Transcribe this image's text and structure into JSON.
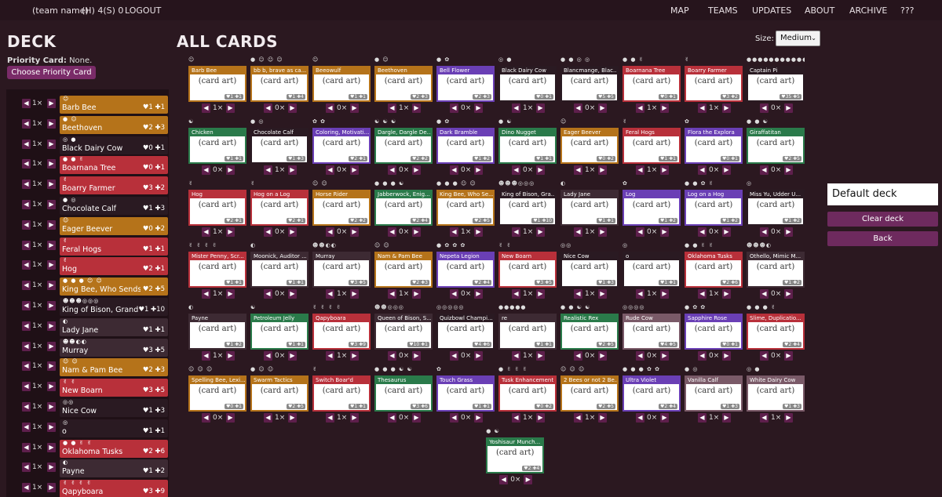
{
  "nav": {
    "team": "(team name)",
    "hunt": "(H) 4(S) 0",
    "logout": "LOGOUT",
    "links": [
      "MAP",
      "TEAMS",
      "UPDATES",
      "ABOUT",
      "ARCHIVE",
      "???"
    ]
  },
  "deck": {
    "title": "DECK",
    "priority_label": "Priority Card:",
    "priority_value": "None.",
    "priority_button": "Choose Priority Card",
    "rows": [
      {
        "name": "Barb Bee",
        "icons": "☺",
        "qty": "1×",
        "stats": "♥1 ✚1",
        "color": "#b5731a"
      },
      {
        "name": "Beethoven",
        "icons": "● ☺",
        "qty": "1×",
        "stats": "♥2 ✚3",
        "color": "#b5731a"
      },
      {
        "name": "Black Dairy Cow",
        "icons": "◎ ●",
        "qty": "1×",
        "stats": "♥0 ✚1",
        "color": "#2a1a22"
      },
      {
        "name": "Boarnana Tree",
        "icons": "● ● ✌",
        "qty": "1×",
        "stats": "♥0 ✚1",
        "color": "#b8303a"
      },
      {
        "name": "Boarry Farmer",
        "icons": "✌",
        "qty": "1×",
        "stats": "♥3 ✚2",
        "color": "#b8303a"
      },
      {
        "name": "Chocolate Calf",
        "icons": "● ◎",
        "qty": "1×",
        "stats": "♥1 ✚3",
        "color": "#2a1a22"
      },
      {
        "name": "Eager Beever",
        "icons": "☺",
        "qty": "1×",
        "stats": "♥0 ✚2",
        "color": "#b5731a"
      },
      {
        "name": "Feral Hogs",
        "icons": "✌",
        "qty": "1×",
        "stats": "♥1 ✚1",
        "color": "#b8303a"
      },
      {
        "name": "Hog",
        "icons": "✌",
        "qty": "1×",
        "stats": "♥2 ✚1",
        "color": "#b8303a"
      },
      {
        "name": "King Bee, Who Sends",
        "icons": "● ● ● ☺ ☺",
        "qty": "1×",
        "stats": "♥2 ✚5",
        "color": "#b5731a"
      },
      {
        "name": "King of Bison, Grand",
        "icons": "☻☻☻◎◎◎",
        "qty": "1×",
        "stats": "♥1 ✚10",
        "color": "#2a1a22"
      },
      {
        "name": "Lady Jane",
        "icons": "◐",
        "qty": "1×",
        "stats": "♥1 ✚1",
        "color": "#3d2a33"
      },
      {
        "name": "Murray",
        "icons": "☻☻◐◐",
        "qty": "1×",
        "stats": "♥3 ✚5",
        "color": "#3d2a33"
      },
      {
        "name": "Nam & Pam Bee",
        "icons": "☺ ☺",
        "qty": "1×",
        "stats": "♥2 ✚3",
        "color": "#b5731a"
      },
      {
        "name": "New Boarn",
        "icons": "✌ ✌",
        "qty": "1×",
        "stats": "♥3 ✚5",
        "color": "#b8303a"
      },
      {
        "name": "Nice Cow",
        "icons": "◎◎",
        "qty": "1×",
        "stats": "♥1 ✚3",
        "color": "#2a1a22"
      },
      {
        "name": "o",
        "icons": "◎",
        "qty": "1×",
        "stats": "♥1 ✚1",
        "color": "#2a1a22"
      },
      {
        "name": "Oklahoma Tusks",
        "icons": "● ● ✌ ✌",
        "qty": "1×",
        "stats": "♥2 ✚6",
        "color": "#b8303a"
      },
      {
        "name": "Payne",
        "icons": "◐",
        "qty": "1×",
        "stats": "♥1 ✚2",
        "color": "#3d2a33"
      },
      {
        "name": "Qapyboara",
        "icons": "✌ ✌ ✌ ✌",
        "qty": "1×",
        "stats": "♥3 ✚9",
        "color": "#b8303a"
      }
    ]
  },
  "all_cards": {
    "title": "ALL CARDS",
    "size_label": "Size:",
    "size_value": "Medium",
    "art_placeholder": "(card art)",
    "cards": [
      {
        "name": "Barb Bee",
        "icons": "☺",
        "qty": "1×",
        "stats": "♥1 ✚1",
        "color": "#b5731a"
      },
      {
        "name": "bb b, brave as ca...",
        "icons": "● ☺ ☺ ☺",
        "qty": "0×",
        "stats": "♥1 ✚4",
        "color": "#b5731a"
      },
      {
        "name": "Beeowulf",
        "icons": "☺",
        "qty": "0×",
        "stats": "♥1 ✚1",
        "color": "#b5731a"
      },
      {
        "name": "Beethoven",
        "icons": "● ☺",
        "qty": "1×",
        "stats": "♥2 ✚3",
        "color": "#b5731a"
      },
      {
        "name": "Bell Flower",
        "icons": "● ✿",
        "qty": "0×",
        "stats": "♥2 ✚3",
        "color": "#6a3fb5"
      },
      {
        "name": "Black Dairy Cow",
        "icons": "◎ ●",
        "qty": "1×",
        "stats": "♥0 ✚1",
        "color": "#2a1a22"
      },
      {
        "name": "Blancmange, Blac...",
        "icons": "● ● ◎ ◎",
        "qty": "0×",
        "stats": "♥5 ✚5",
        "color": "#2a1a22"
      },
      {
        "name": "Boarnana Tree",
        "icons": "● ● ✌",
        "qty": "1×",
        "stats": "♥0 ✚1",
        "color": "#b8303a"
      },
      {
        "name": "Boarry Farmer",
        "icons": "✌",
        "qty": "1×",
        "stats": "♥3 ✚2",
        "color": "#b8303a"
      },
      {
        "name": "Captain Pi",
        "icons": "●●●●●●●●●●●●",
        "qty": "0×",
        "stats": "♥35 ✚5",
        "color": "#2a1a22"
      },
      {
        "name": "Chicken",
        "icons": "☯",
        "qty": "0×",
        "stats": "♥1 ✚1",
        "color": "#2a7a4a"
      },
      {
        "name": "Chocolate Calf",
        "icons": "● ◎",
        "qty": "1×",
        "stats": "♥1 ✚3",
        "color": "#2a1a22"
      },
      {
        "name": "Coloring, Motivati...",
        "icons": "✿ ✿",
        "qty": "0×",
        "stats": "♥2 ✚1",
        "color": "#6a3fb5"
      },
      {
        "name": "Dargle, Dargle De...",
        "icons": "☯ ☯ ☯",
        "qty": "0×",
        "stats": "♥2 ✚2",
        "color": "#2a7a4a"
      },
      {
        "name": "Dark Bramble",
        "icons": "● ✿",
        "qty": "0×",
        "stats": "♥1 ✚2",
        "color": "#6a3fb5"
      },
      {
        "name": "Dino Nugget",
        "icons": "● ☯",
        "qty": "0×",
        "stats": "♥1 ✚1",
        "color": "#2a7a4a"
      },
      {
        "name": "Eager Beever",
        "icons": "☺",
        "qty": "1×",
        "stats": "♥0 ✚2",
        "color": "#b5731a"
      },
      {
        "name": "Feral Hogs",
        "icons": "✌",
        "qty": "1×",
        "stats": "♥1 ✚1",
        "color": "#b8303a"
      },
      {
        "name": "Flora the Explora",
        "icons": "✿",
        "qty": "0×",
        "stats": "♥0 ✚1",
        "color": "#6a3fb5"
      },
      {
        "name": "Giraffatitan",
        "icons": "● ● ☯",
        "qty": "0×",
        "stats": "♥2 ✚5",
        "color": "#2a7a4a"
      },
      {
        "name": "Hog",
        "icons": "✌",
        "qty": "1×",
        "stats": "♥2 ✚1",
        "color": "#b8303a"
      },
      {
        "name": "Hog on a Log",
        "icons": "✌",
        "qty": "0×",
        "stats": "♥2 ✚1",
        "color": "#b8303a"
      },
      {
        "name": "Horse Rider",
        "icons": "☺ ☺",
        "qty": "0×",
        "stats": "♥2 ✚2",
        "color": "#b5731a"
      },
      {
        "name": "Jabberwock, Enig...",
        "icons": "● ● ● ☯",
        "qty": "0×",
        "stats": "♥2 ✚4",
        "color": "#2a7a4a"
      },
      {
        "name": "King Bee, Who Se...",
        "icons": "● ● ● ☺ ☺",
        "qty": "1×",
        "stats": "♥2 ✚5",
        "color": "#b5731a"
      },
      {
        "name": "King of Bison, Gra...",
        "icons": "☻☻☻◎◎◎",
        "qty": "1×",
        "stats": "♥1 ✚10",
        "color": "#2a1a22"
      },
      {
        "name": "Lady Jane",
        "icons": "◐",
        "qty": "1×",
        "stats": "♥1 ✚1",
        "color": "#3d2a33"
      },
      {
        "name": "Log",
        "icons": "✿",
        "qty": "0×",
        "stats": "♥1 ✚2",
        "color": "#6a3fb5"
      },
      {
        "name": "Log on a Hog",
        "icons": "● ● ✿ ✌",
        "qty": "0×",
        "stats": "♥1 ✚2",
        "color": "#6a3fb5"
      },
      {
        "name": "Miss Yu, Udder U...",
        "icons": "◎",
        "qty": "0×",
        "stats": "♥1 ✚2",
        "color": "#2a1a22"
      },
      {
        "name": "Mister Penny, Scr...",
        "icons": "✌ ✌ ✌ ✌",
        "qty": "1×",
        "stats": "♥1 ✚1",
        "color": "#b8303a"
      },
      {
        "name": "Moonick, Auditor ...",
        "icons": "◐",
        "qty": "0×",
        "stats": "♥1 ✚1",
        "color": "#3d2a33"
      },
      {
        "name": "Murray",
        "icons": "☻☻◐◐",
        "qty": "1×",
        "stats": "♥3 ✚5",
        "color": "#3d2a33"
      },
      {
        "name": "Nam & Pam Bee",
        "icons": "☺ ☺",
        "qty": "1×",
        "stats": "♥2 ✚3",
        "color": "#b5731a"
      },
      {
        "name": "Nepeta Legion",
        "icons": "● ✿ ✿ ✿",
        "qty": "0×",
        "stats": "♥2 ✚4",
        "color": "#6a3fb5"
      },
      {
        "name": "New Boarn",
        "icons": "✌ ✌",
        "qty": "1×",
        "stats": "♥3 ✚5",
        "color": "#b8303a"
      },
      {
        "name": "Nice Cow",
        "icons": "◎◎",
        "qty": "1×",
        "stats": "♥1 ✚3",
        "color": "#2a1a22"
      },
      {
        "name": "o",
        "icons": "◎",
        "qty": "1×",
        "stats": "♥1 ✚1",
        "color": "#2a1a22"
      },
      {
        "name": "Oklahoma Tusks",
        "icons": "● ● ✌ ✌",
        "qty": "1×",
        "stats": "♥2 ✚6",
        "color": "#b8303a"
      },
      {
        "name": "Othello, Mimic M...",
        "icons": "☻☻☻◐",
        "qty": "0×",
        "stats": "♥1 ✚2",
        "color": "#3d2a33"
      },
      {
        "name": "Payne",
        "icons": "◐",
        "qty": "1×",
        "stats": "♥1 ✚2",
        "color": "#3d2a33"
      },
      {
        "name": "Petroleum Jelly",
        "icons": "☯",
        "qty": "0×",
        "stats": "♥1 ✚1",
        "color": "#2a7a4a"
      },
      {
        "name": "Qapyboara",
        "icons": "✌ ✌ ✌ ✌",
        "qty": "1×",
        "stats": "♥3 ✚9",
        "color": "#b8303a"
      },
      {
        "name": "Queen of Bison, S...",
        "icons": "☻☻◎◎◎",
        "qty": "0×",
        "stats": "♥10 ✚1",
        "color": "#3d2a33"
      },
      {
        "name": "Quizbowl Champi...",
        "icons": "◎◎◎◎◎",
        "qty": "0×",
        "stats": "♥4 ✚6",
        "color": "#2a1a22"
      },
      {
        "name": "re",
        "icons": "●●●●●",
        "qty": "1×",
        "stats": "♥1 ✚1",
        "color": "#3d2a33"
      },
      {
        "name": "Realistic Rex",
        "icons": "● ● ☯ ☯",
        "qty": "0×",
        "stats": "♥2 ✚5",
        "color": "#2a7a4a"
      },
      {
        "name": "Rude Cow",
        "icons": "◎◎◎◎",
        "qty": "0×",
        "stats": "♥4 ✚5",
        "color": "#7a5a68"
      },
      {
        "name": "Sapphire Rose",
        "icons": "● ✿ ✿",
        "qty": "0×",
        "stats": "♥0 ✚1",
        "color": "#6a3fb5"
      },
      {
        "name": "Slime, Duplicatio...",
        "icons": "● ● ● ✌",
        "qty": "0×",
        "stats": "♥2 ✚4",
        "color": "#b8303a"
      },
      {
        "name": "Spelling Bee, Lexi...",
        "icons": "☺ ☺ ☺",
        "qty": "0×",
        "stats": "♥0 ✚1",
        "color": "#b5731a"
      },
      {
        "name": "Swarm Tactics",
        "icons": "● ☺ ☺",
        "qty": "1×",
        "stats": "♥2 ✚5",
        "color": "#b5731a"
      },
      {
        "name": "Switch Boar'd",
        "icons": "✌",
        "qty": "1×",
        "stats": "♥1 ✚1",
        "color": "#b8303a"
      },
      {
        "name": "Thesaurus",
        "icons": "● ● ● ☯ ☯",
        "qty": "0×",
        "stats": "♥3 ✚6",
        "color": "#2a7a4a"
      },
      {
        "name": "Touch Grass",
        "icons": "✿",
        "qty": "0×",
        "stats": "♥1 ✚1",
        "color": "#6a3fb5"
      },
      {
        "name": "Tusk Enhancement",
        "icons": "● ✌ ✌ ✌",
        "qty": "1×",
        "stats": "♥0 ✚2",
        "color": "#b8303a"
      },
      {
        "name": "2 Bees or not 2 Be...",
        "icons": "☺ ☺ ☺",
        "qty": "1×",
        "stats": "♥2 ✚5",
        "color": "#b5731a"
      },
      {
        "name": "Ultra Violet",
        "icons": "● ● ● ✿ ✿",
        "qty": "0×",
        "stats": "♥2 ✚4",
        "color": "#6a3fb5"
      },
      {
        "name": "Vanilla Calf",
        "icons": "● ◎",
        "qty": "1×",
        "stats": "♥1 ✚3",
        "color": "#7a5a68"
      },
      {
        "name": "White Dairy Cow",
        "icons": "◎ ●",
        "qty": "1×",
        "stats": "♥1 ✚3",
        "color": "#7a5a68"
      },
      {
        "name": "Yoshisaur Munch...",
        "icons": "● ☯",
        "qty": "0×",
        "stats": "♥2 ✚4",
        "color": "#2a7a4a"
      }
    ]
  },
  "side": {
    "deck_name": "Default deck",
    "clear": "Clear deck",
    "back": "Back"
  }
}
